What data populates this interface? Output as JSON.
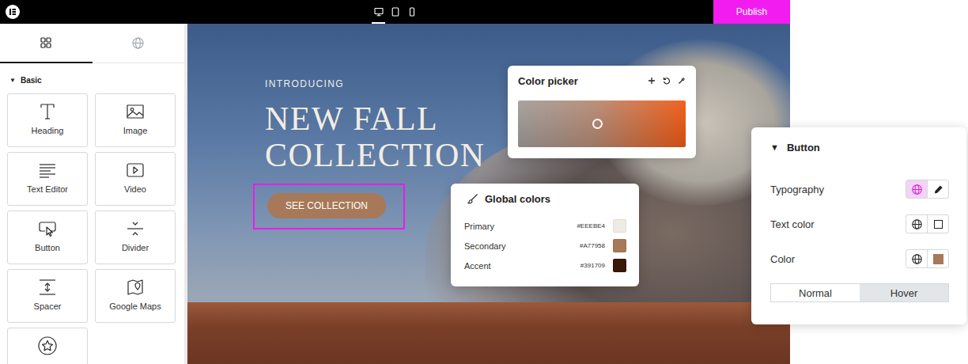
{
  "topbar": {
    "devices": [
      {
        "kind": "desktop",
        "selected": true
      },
      {
        "kind": "tablet",
        "selected": false
      },
      {
        "kind": "mobile",
        "selected": false
      }
    ],
    "publish": "Publish"
  },
  "sidebar": {
    "tabs": [
      {
        "kind": "widgets",
        "selected": true
      },
      {
        "kind": "globals",
        "selected": false
      }
    ],
    "section": {
      "toggle": "▼",
      "label": "Basic",
      "expanded": true
    },
    "widgets": [
      {
        "kind": "heading",
        "label": "Heading"
      },
      {
        "kind": "image",
        "label": "Image"
      },
      {
        "kind": "text-editor",
        "label": "Text Editor"
      },
      {
        "kind": "video",
        "label": "Video"
      },
      {
        "kind": "button",
        "label": "Button"
      },
      {
        "kind": "divider",
        "label": "Divider"
      },
      {
        "kind": "spacer",
        "label": "Spacer"
      },
      {
        "kind": "maps",
        "label": "Google Maps"
      },
      {
        "kind": "star"
      }
    ]
  },
  "canvas": {
    "eyebrow": "INTRODUCING",
    "headline": [
      "NEW FALL",
      "COLLECTION"
    ],
    "cta": {
      "label": "SEE COLLECTION",
      "selected": true
    }
  },
  "color_picker": {
    "title": "Color picker"
  },
  "global_colors": {
    "title": "Global colors",
    "colors": [
      {
        "name": "Primary",
        "value": "#EEEBE4",
        "color": "#EEEBE4"
      },
      {
        "name": "Secondary",
        "value": "#A77958",
        "color": "#A77958"
      },
      {
        "name": "Accent",
        "value": "#391709",
        "color": "#391709"
      }
    ]
  },
  "button_panel": {
    "toggle": "▼",
    "title": "Button",
    "expanded": true,
    "rows": [
      {
        "label": "Typography",
        "kind": "edit",
        "global_active": true
      },
      {
        "label": "Text color",
        "kind": "empty",
        "global_active": false
      },
      {
        "label": "Color",
        "kind": "swatch",
        "color": "#A77958",
        "global_active": false
      }
    ],
    "states": [
      {
        "label": "Normal",
        "selected": false
      },
      {
        "label": "Hover",
        "selected": true
      }
    ]
  }
}
